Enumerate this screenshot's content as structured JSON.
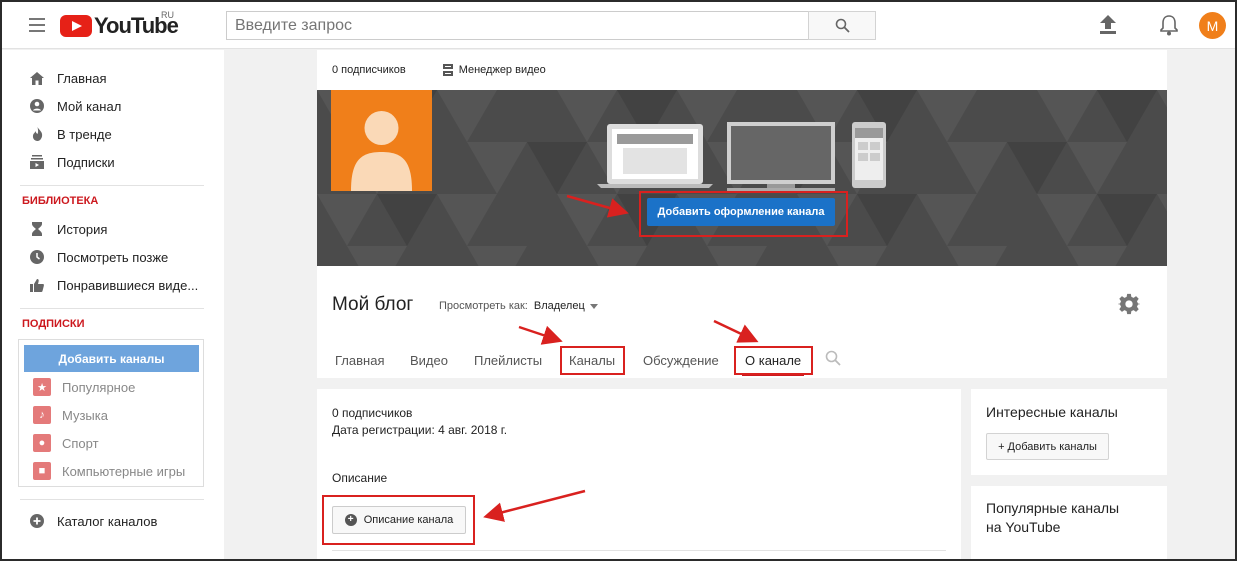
{
  "header": {
    "logo_text": "YouTube",
    "logo_region": "RU",
    "search_placeholder": "Введите запрос",
    "avatar_letter": "M",
    "icons": [
      "menu-icon",
      "search-icon",
      "upload-icon",
      "bell-icon"
    ]
  },
  "sidebar": {
    "main_items": [
      {
        "label": "Главная",
        "icon": "home-icon"
      },
      {
        "label": "Мой канал",
        "icon": "person-icon"
      },
      {
        "label": "В тренде",
        "icon": "fire-icon"
      },
      {
        "label": "Подписки",
        "icon": "subscriptions-icon"
      }
    ],
    "library_title": "БИБЛИОТЕКА",
    "library_items": [
      {
        "label": "История",
        "icon": "hourglass-icon"
      },
      {
        "label": "Посмотреть позже",
        "icon": "clock-icon"
      },
      {
        "label": "Понравившиеся виде...",
        "icon": "thumbs-up-icon"
      }
    ],
    "subscriptions_title": "ПОДПИСКИ",
    "add_channels_label": "Добавить каналы",
    "subscription_items": [
      {
        "label": "Популярное",
        "icon": "star-icon"
      },
      {
        "label": "Музыка",
        "icon": "music-icon"
      },
      {
        "label": "Спорт",
        "icon": "ball-icon"
      },
      {
        "label": "Компьютерные игры",
        "icon": "gamepad-icon"
      }
    ],
    "catalog_label": "Каталог каналов"
  },
  "channel": {
    "subscribers": "0 подписчиков",
    "video_manager": "Менеджер видео",
    "add_art_button": "Добавить оформление канала",
    "title": "Мой блог",
    "view_as_label": "Просмотреть как:",
    "view_as_value": "Владелец",
    "tabs": [
      "Главная",
      "Видео",
      "Плейлисты",
      "Каналы",
      "Обсуждение",
      "О канале"
    ],
    "active_tab": "О канале"
  },
  "about": {
    "subscribers": "0 подписчиков",
    "joined": "Дата регистрации: 4 авг. 2018 г.",
    "description_heading": "Описание",
    "description_button": "Описание канала"
  },
  "right_column": {
    "featured_title": "Интересные каналы",
    "featured_add": "+ Добавить каналы",
    "popular_title_1": "Популярные каналы",
    "popular_title_2": "на YouTube"
  },
  "colors": {
    "brand_red": "#e62117",
    "accent_blue": "#1b72c8",
    "annotation_red": "#d9211f",
    "avatar_orange": "#f07f1a"
  }
}
